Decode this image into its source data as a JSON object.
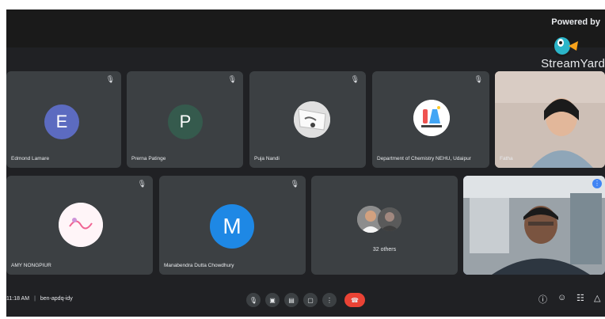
{
  "branding": {
    "powered_by": "Powered by",
    "name": "StreamYard"
  },
  "tiles": [
    {
      "label": "Edmond Lamare",
      "initial": "E",
      "color": "#5c6bc0"
    },
    {
      "label": "Prerna Patinge",
      "initial": "P",
      "color": "#355a4d"
    },
    {
      "label": "Puja Nandi"
    },
    {
      "label": "Department of Chemistry NEHU, Udaipur"
    },
    {
      "label": "Fatha"
    },
    {
      "label": "AMY NONGPIUR"
    },
    {
      "label": "Manabendra Dutta Chowdhury",
      "initial": "M",
      "color": "#1e88e5"
    },
    {
      "label": "32 others"
    },
    {
      "label": ""
    }
  ],
  "bottom_bar": {
    "time": "11:18 AM",
    "meeting_code": "ben-apdq-idy"
  },
  "colors": {
    "end_call": "#ea4335",
    "active_border": "#8ab4f8",
    "tile_bg": "#3c4043"
  },
  "icons": {
    "tile_mic": "mic-icon",
    "controls": [
      "mic-icon",
      "camera-icon",
      "captions-icon",
      "present-icon",
      "more-options-icon",
      "end-call-icon"
    ],
    "right": [
      "info-icon",
      "people-icon",
      "chat-icon",
      "activities-icon"
    ]
  }
}
